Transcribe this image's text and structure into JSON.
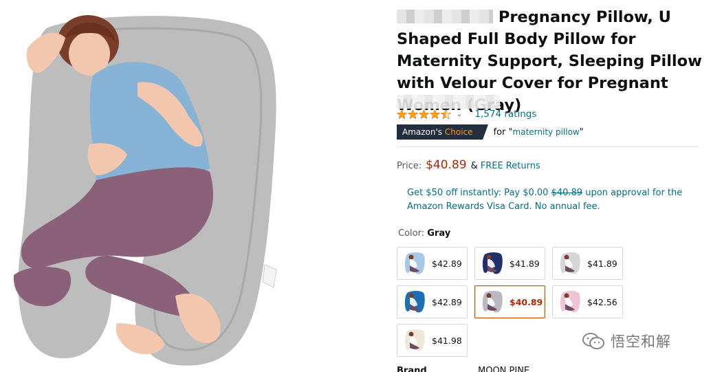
{
  "product": {
    "title_visible": "Pregnancy Pillow, U Shaped Full Body Pillow for Maternity Support, Sleeping Pillow with Velour Cover for Pregnant Women (Gray)",
    "image_alt": "Woman sleeping on gray U shaped pregnancy pillow"
  },
  "rating": {
    "stars": 4.5,
    "count_label": "1,574 ratings"
  },
  "choice": {
    "badge_prefix": "Amazon's",
    "badge_suffix": "Choice",
    "for_label": "for \"",
    "keyword": "maternity pillow",
    "close_quote": "\""
  },
  "price": {
    "label": "Price:",
    "value": "$40.89",
    "amp": "&",
    "free_returns": "FREE Returns"
  },
  "promo": {
    "line_before": "Get $50 off instantly: Pay $0.00 ",
    "struck": "$40.89",
    "line_after": " upon approval for the Amazon Rewards Visa Card. No annual fee."
  },
  "color": {
    "label": "Color: ",
    "selected": "Gray"
  },
  "swatches": [
    {
      "price": "$42.89",
      "color": "#a9c8e8"
    },
    {
      "price": "$41.89",
      "color": "#1e2f6b"
    },
    {
      "price": "$41.89",
      "color": "#d6d6d6"
    },
    {
      "price": "$42.89",
      "color": "#1f6fb5"
    },
    {
      "price": "$40.89",
      "color": "#b9b9c2"
    },
    {
      "price": "$42.56",
      "color": "#f0c4d4"
    },
    {
      "price": "$41.98",
      "color": "#efe7d8"
    }
  ],
  "details": {
    "brand_key": "Brand",
    "brand_value": "MOON PINE"
  },
  "watermark": {
    "text": "悟空和解"
  },
  "colors": {
    "link": "#007185",
    "price": "#b12704",
    "star": "#ffa41c",
    "badge_bg": "#232f3e",
    "badge_accent": "#ff9900",
    "selected_border": "#c45500"
  }
}
